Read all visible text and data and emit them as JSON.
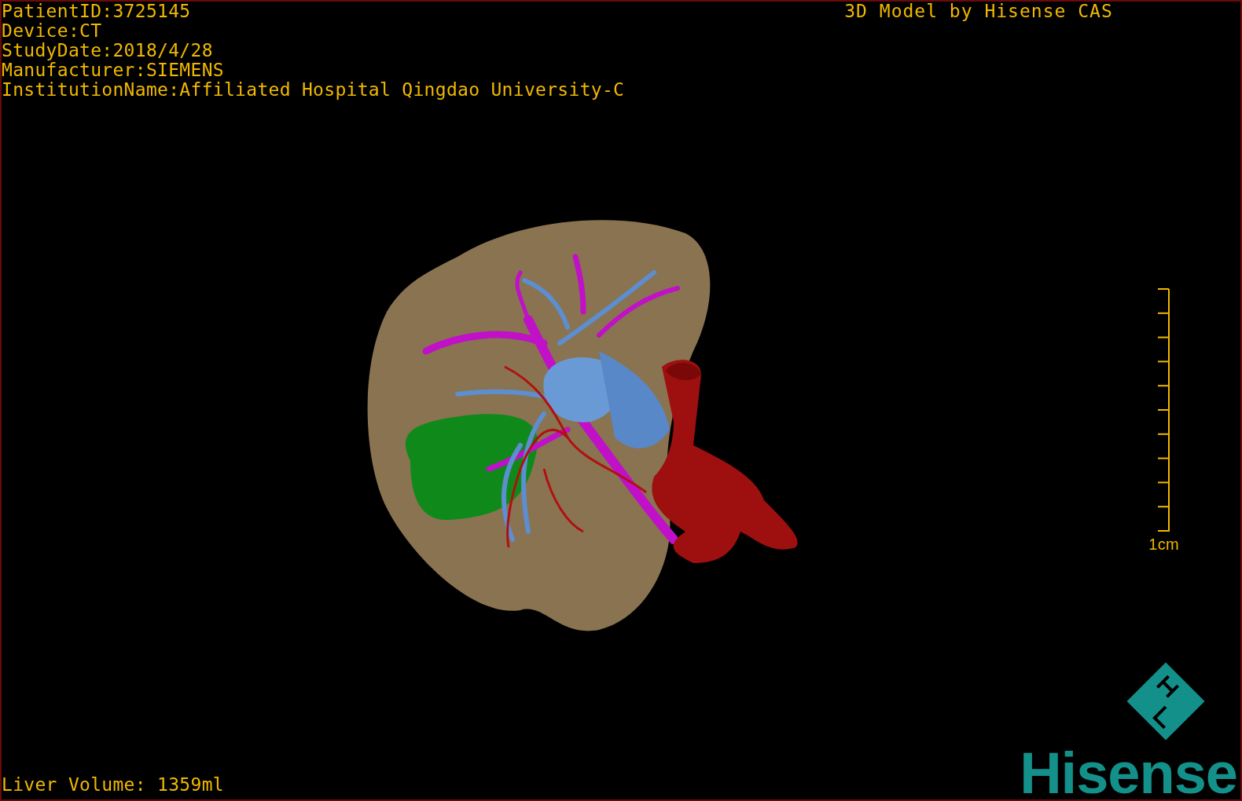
{
  "info_lines": [
    "PatientID:3725145",
    "Device:CT",
    "StudyDate:2018/4/28",
    "Manufacturer:SIEMENS",
    "InstitutionName:Affiliated Hospital Qingdao University-C"
  ],
  "title": "3D Model by Hisense CAS",
  "scale_bar": {
    "label": "1cm"
  },
  "liver_volume": "Liver Volume: 1359ml",
  "logo": {
    "text": "Hisense"
  }
}
